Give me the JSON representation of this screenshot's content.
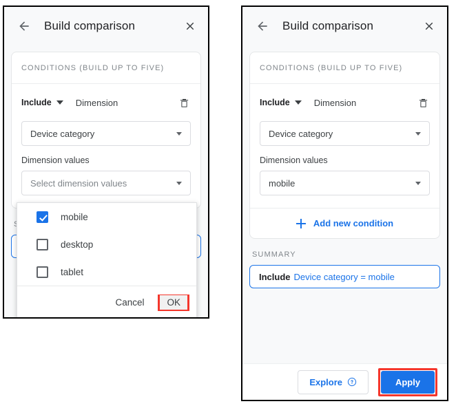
{
  "panels": {
    "left": {
      "header": {
        "title": "Build comparison",
        "back_icon": "arrow-left-icon",
        "close_icon": "close-icon"
      },
      "conditions_header": "CONDITIONS (BUILD UP TO FIVE)",
      "condition": {
        "include_label": "Include",
        "caret_icon": "chevron-down-icon",
        "scope_label": "Dimension",
        "delete_icon": "trash-icon",
        "dimension_value": "Device category",
        "dimension_values_label": "Dimension values",
        "values_placeholder": "Select dimension values"
      },
      "summary_label": "SUMMARY",
      "dropdown": {
        "options": [
          {
            "label": "mobile",
            "checked": true
          },
          {
            "label": "desktop",
            "checked": false
          },
          {
            "label": "tablet",
            "checked": false
          }
        ],
        "cancel_label": "Cancel",
        "ok_label": "OK",
        "ok_highlight_color": "#f4362c"
      }
    },
    "right": {
      "header": {
        "title": "Build comparison",
        "back_icon": "arrow-left-icon",
        "close_icon": "close-icon"
      },
      "conditions_header": "CONDITIONS (BUILD UP TO FIVE)",
      "condition": {
        "include_label": "Include",
        "caret_icon": "chevron-down-icon",
        "scope_label": "Dimension",
        "delete_icon": "trash-icon",
        "dimension_value": "Device category",
        "dimension_values_label": "Dimension values",
        "values_value": "mobile"
      },
      "add_condition_label": "Add new condition",
      "summary_label": "SUMMARY",
      "summary_chip": {
        "include": "Include",
        "expression": "Device category = mobile"
      },
      "footer": {
        "explore_label": "Explore",
        "explore_help_icon": "help-circle-icon",
        "apply_label": "Apply",
        "apply_highlight_color": "#f4362c"
      }
    }
  },
  "colors": {
    "accent_blue": "#1a73e8",
    "highlight_red": "#f4362c",
    "body_bg": "#f8f9fa"
  }
}
